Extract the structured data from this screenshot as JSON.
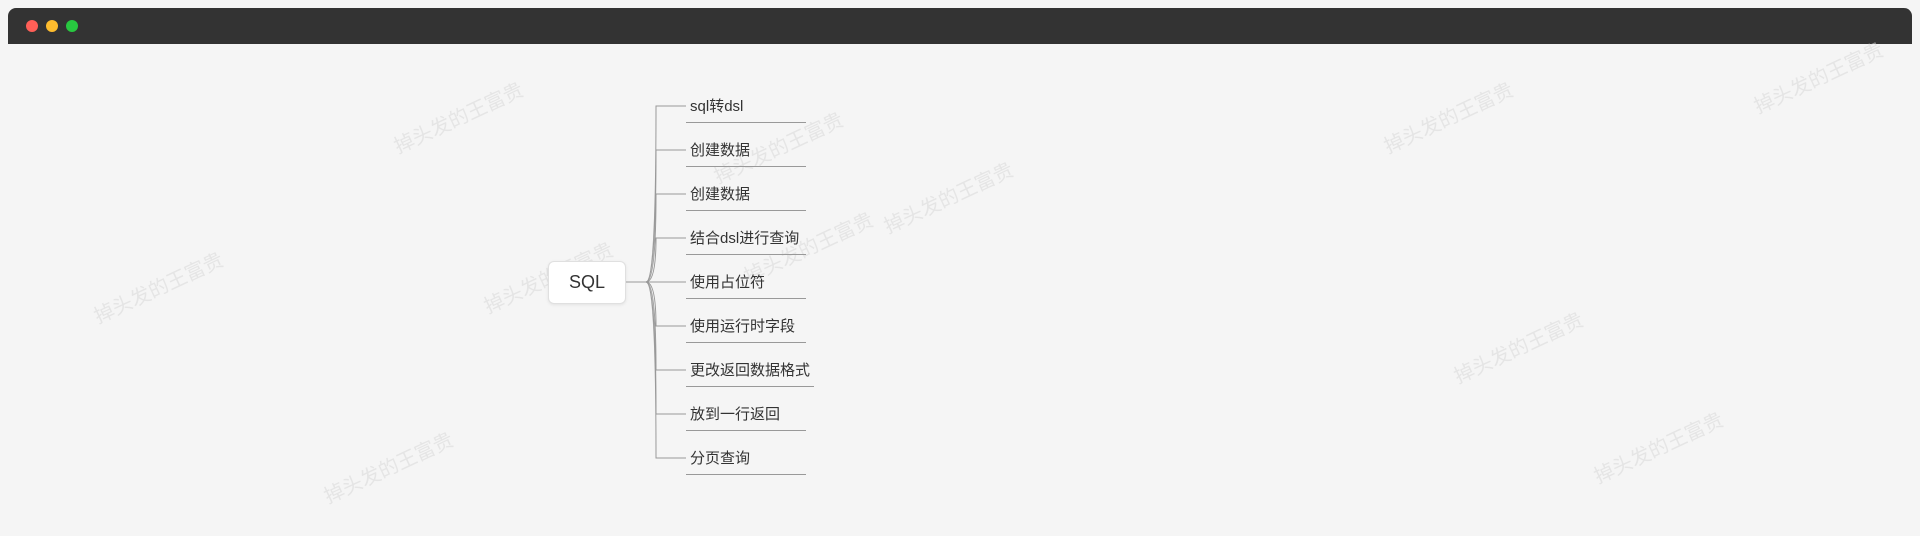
{
  "titlebar": {
    "traffic_lights": [
      "close",
      "minimize",
      "maximize"
    ]
  },
  "mindmap": {
    "root": "SQL",
    "children": [
      "sql转dsl",
      "创建数据",
      "创建数据",
      "结合dsl进行查询",
      "使用占位符",
      "使用运行时字段",
      "更改返回数据格式",
      "放到一行返回",
      "分页查询"
    ]
  },
  "watermark_text": "掉头发的王富贵"
}
